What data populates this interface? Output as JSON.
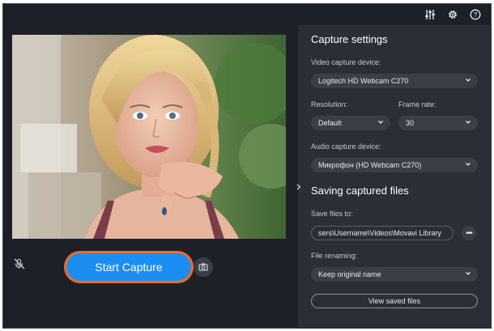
{
  "toolbar": {
    "icons": [
      "equalizer-icon",
      "gear-icon",
      "help-icon"
    ]
  },
  "preview": {
    "icon": "webcam-preview-image"
  },
  "controls": {
    "start_label": "Start Capture",
    "mute_icon": "microphone-muted-icon",
    "snapshot_icon": "camera-icon"
  },
  "capture": {
    "title": "Capture settings",
    "video_label": "Video capture device:",
    "video_value": "Logitech HD Webcam C270",
    "resolution_label": "Resolution:",
    "resolution_value": "Default",
    "framerate_label": "Frame rate:",
    "framerate_value": "30",
    "audio_label": "Audio capture device:",
    "audio_value": "Микрофон (HD Webcam C270)"
  },
  "saving": {
    "title": "Saving captured files",
    "save_label": "Save files to:",
    "save_path": "sers\\Username\\Videos\\Movavi Library",
    "browse_label": "•••",
    "rename_label": "File renaming:",
    "rename_value": "Keep original name",
    "view_label": "View saved files"
  },
  "colors": {
    "accent": "#1c8ef2",
    "highlight": "#f26a23",
    "panel": "#2a2f36",
    "background": "#1d2127"
  }
}
